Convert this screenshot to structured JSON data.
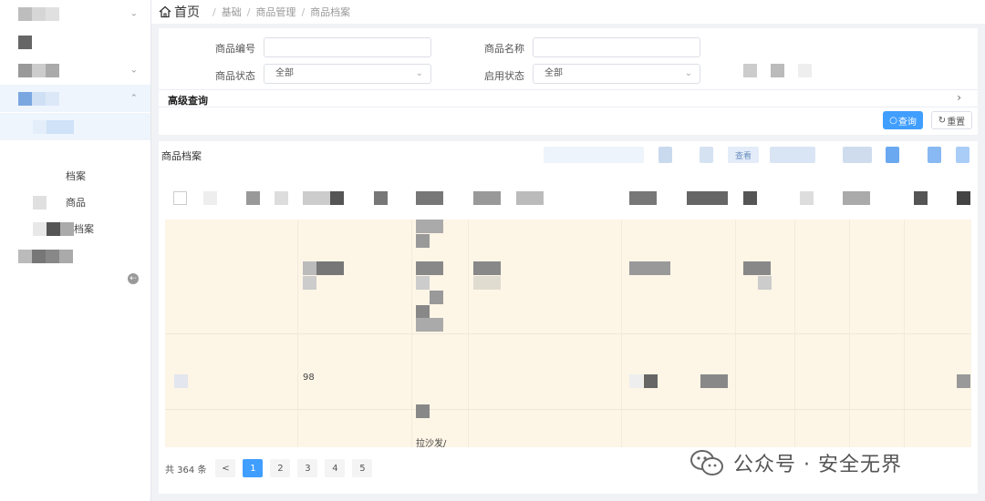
{
  "breadcrumb": {
    "home": "首页",
    "items": [
      "基础",
      "商品管理",
      "商品档案"
    ]
  },
  "sidebar": {
    "sub_items": [
      "档案",
      "商品",
      "档案"
    ],
    "collapse_glyph": "⇠"
  },
  "filters": {
    "product_code_label": "商品编号",
    "product_name_label": "商品名称",
    "product_status_label": "商品状态",
    "product_status_value": "全部",
    "enable_status_label": "启用状态",
    "enable_status_value": "全部",
    "advanced_label": "高级查询",
    "query_label": "查询",
    "reset_label": "重置"
  },
  "table": {
    "title": "商品档案",
    "view_label": "查看",
    "cell_fragments": [
      "拉沙发/",
      "98"
    ]
  },
  "pagination": {
    "total": "共 364 条",
    "prev": "<",
    "pages": [
      "1",
      "2",
      "3",
      "4",
      "5"
    ],
    "current": "1"
  },
  "watermark": {
    "text": "公众号 · 安全无界"
  },
  "colors": {
    "accent": "#409eff",
    "row_highlight": "#fdf5e6",
    "sidebar_active": "#eef5fd"
  }
}
